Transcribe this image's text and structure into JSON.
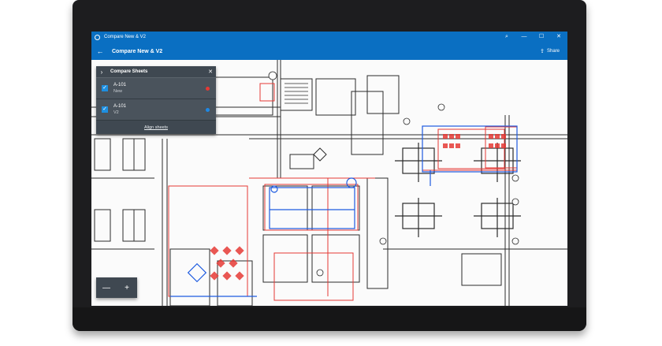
{
  "window": {
    "title": "Compare New & V2",
    "minimize_glyph": "—",
    "maximize_glyph": "☐",
    "close_glyph": "✕",
    "search_glyph": "⌕"
  },
  "appbar": {
    "back_glyph": "←",
    "title": "Compare New & V2",
    "share_label": "Share",
    "share_glyph": "⇪"
  },
  "compare_panel": {
    "title": "Compare Sheets",
    "expand_glyph": "›",
    "close_glyph": "✕",
    "sheets": [
      {
        "name": "A-101",
        "version": "New",
        "checked": true,
        "color": "#e53935"
      },
      {
        "name": "A-101",
        "version": "V2",
        "checked": true,
        "color": "#1e88e5"
      }
    ],
    "align_label": "Align sheets"
  },
  "zoom": {
    "minus_glyph": "—",
    "plus_glyph": "+"
  },
  "colors": {
    "accent": "#0a6fc2",
    "panel": "#3f4851",
    "overlay_red": "#e53935",
    "overlay_blue": "#1e5be0",
    "linework": "#2b2b2b"
  }
}
